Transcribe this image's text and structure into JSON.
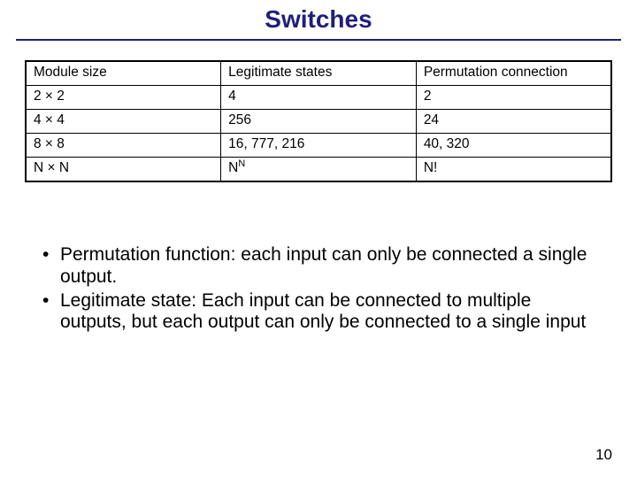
{
  "title": "Switches",
  "table": {
    "headers": [
      "Module size",
      "Legitimate states",
      "Permutation connection"
    ],
    "rows": [
      {
        "module": "2 × 2",
        "legit": "4",
        "perm": "2"
      },
      {
        "module": "4 × 4",
        "legit": "256",
        "perm": "24"
      },
      {
        "module": "8 × 8",
        "legit": "16, 777, 216",
        "perm": "40, 320"
      },
      {
        "module": "N × N",
        "legit_base": "N",
        "legit_sup": "N",
        "perm": "N!"
      }
    ]
  },
  "bullets": [
    "Permutation function: each input can only be connected a single output.",
    "Legitimate state: Each input can be connected to multiple outputs, but each output can only be connected to a single input"
  ],
  "pageNumber": "10",
  "chart_data": {
    "type": "table",
    "title": "Switches",
    "columns": [
      "Module size",
      "Legitimate states",
      "Permutation connection"
    ],
    "rows": [
      [
        "2 × 2",
        "4",
        "2"
      ],
      [
        "4 × 4",
        "256",
        "24"
      ],
      [
        "8 × 8",
        "16,777,216",
        "40,320"
      ],
      [
        "N × N",
        "N^N",
        "N!"
      ]
    ]
  }
}
